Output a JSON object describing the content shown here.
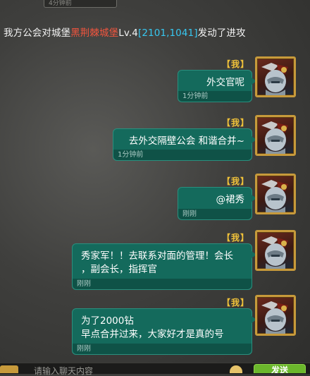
{
  "top_stub": {
    "text": "4分钟前"
  },
  "system_message": {
    "prefix": "我方公会对城堡",
    "castle_name": "黑荆棘城堡",
    "level": "Lv.4",
    "coords": "[2101,1041]",
    "suffix": "发动了进攻"
  },
  "messages": [
    {
      "sender": "【我】",
      "text": "外交官呢",
      "time": "1分钟前"
    },
    {
      "sender": "【我】",
      "text": "去外交隔壁公会  和谐合并~",
      "time": "1分钟前"
    },
    {
      "sender": "【我】",
      "text": "@裙秀",
      "time": "刚刚"
    },
    {
      "sender": "【我】",
      "text": "秀家军！！去联系对面的管理！会长\n，副会长，指挥官",
      "time": "刚刚"
    },
    {
      "sender": "【我】",
      "text": "为了2000钻\n早点合并过来，大家好才是真的号",
      "time": "刚刚"
    }
  ],
  "input": {
    "placeholder": "请输入聊天内容"
  },
  "send_button": {
    "label": "发送"
  },
  "colors": {
    "bubble": "#146a5c",
    "sender": "#f0c23a",
    "castle": "#f2553e",
    "coords": "#37c7f0",
    "send": "#6bb72c"
  },
  "icons": {
    "avatar": "armored-knight-avatar",
    "emoji": "emoji-icon"
  }
}
